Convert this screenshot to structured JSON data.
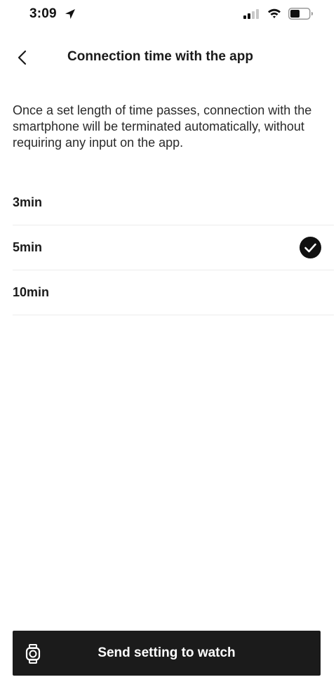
{
  "status_bar": {
    "time": "3:09"
  },
  "header": {
    "back_icon": "chevron-left-icon",
    "title": "Connection time with the app"
  },
  "description": "Once a set length of time passes, connection with the smartphone will be terminated automatically, without requiring any input on the app.",
  "options": [
    {
      "label": "3min",
      "selected": false
    },
    {
      "label": "5min",
      "selected": true
    },
    {
      "label": "10min",
      "selected": false
    }
  ],
  "send_button": {
    "icon": "watch-icon",
    "label": "Send setting to watch"
  },
  "colors": {
    "background": "#ffffff",
    "text": "#1a1a1a",
    "button_background": "#1b1b1b",
    "button_text": "#ffffff",
    "divider": "#ececec"
  }
}
